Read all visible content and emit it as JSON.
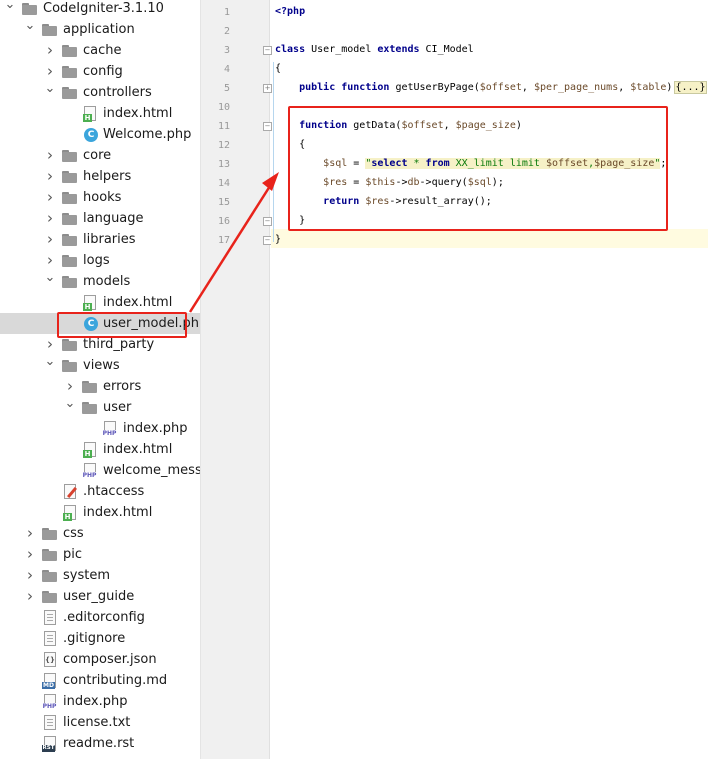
{
  "tree": {
    "items": [
      {
        "label": "CodeIgniter-3.1.10",
        "kind": "folder",
        "depth": 0,
        "open": true
      },
      {
        "label": "application",
        "kind": "folder",
        "depth": 1,
        "open": true
      },
      {
        "label": "cache",
        "kind": "folder",
        "depth": 2,
        "open": false
      },
      {
        "label": "config",
        "kind": "folder",
        "depth": 2,
        "open": false
      },
      {
        "label": "controllers",
        "kind": "folder",
        "depth": 2,
        "open": true
      },
      {
        "label": "index.html",
        "kind": "html",
        "depth": 3
      },
      {
        "label": "Welcome.php",
        "kind": "class",
        "depth": 3
      },
      {
        "label": "core",
        "kind": "folder",
        "depth": 2,
        "open": false
      },
      {
        "label": "helpers",
        "kind": "folder",
        "depth": 2,
        "open": false
      },
      {
        "label": "hooks",
        "kind": "folder",
        "depth": 2,
        "open": false
      },
      {
        "label": "language",
        "kind": "folder",
        "depth": 2,
        "open": false
      },
      {
        "label": "libraries",
        "kind": "folder",
        "depth": 2,
        "open": false
      },
      {
        "label": "logs",
        "kind": "folder",
        "depth": 2,
        "open": false
      },
      {
        "label": "models",
        "kind": "folder",
        "depth": 2,
        "open": true
      },
      {
        "label": "index.html",
        "kind": "html",
        "depth": 3
      },
      {
        "label": "user_model.php",
        "kind": "class",
        "depth": 3,
        "selected": true
      },
      {
        "label": "third_party",
        "kind": "folder",
        "depth": 2,
        "open": false
      },
      {
        "label": "views",
        "kind": "folder",
        "depth": 2,
        "open": true
      },
      {
        "label": "errors",
        "kind": "folder",
        "depth": 3,
        "open": false
      },
      {
        "label": "user",
        "kind": "folder",
        "depth": 3,
        "open": true
      },
      {
        "label": "index.php",
        "kind": "php",
        "depth": 4
      },
      {
        "label": "index.html",
        "kind": "html",
        "depth": 3
      },
      {
        "label": "welcome_message.php",
        "kind": "php",
        "depth": 3
      },
      {
        "label": ".htaccess",
        "kind": "htaccess",
        "depth": 2
      },
      {
        "label": "index.html",
        "kind": "html",
        "depth": 2
      },
      {
        "label": "css",
        "kind": "folder",
        "depth": 1,
        "open": false
      },
      {
        "label": "pic",
        "kind": "folder",
        "depth": 1,
        "open": false
      },
      {
        "label": "system",
        "kind": "folder",
        "depth": 1,
        "open": false
      },
      {
        "label": "user_guide",
        "kind": "folder",
        "depth": 1,
        "open": false
      },
      {
        "label": ".editorconfig",
        "kind": "text",
        "depth": 1
      },
      {
        "label": ".gitignore",
        "kind": "text",
        "depth": 1
      },
      {
        "label": "composer.json",
        "kind": "json",
        "depth": 1
      },
      {
        "label": "contributing.md",
        "kind": "md",
        "depth": 1
      },
      {
        "label": "index.php",
        "kind": "php",
        "depth": 1
      },
      {
        "label": "license.txt",
        "kind": "text",
        "depth": 1
      },
      {
        "label": "readme.rst",
        "kind": "rst",
        "depth": 1
      }
    ]
  },
  "icons": {
    "folder": "folder-icon",
    "html": "html-file-icon",
    "class": "php-class-icon",
    "php": "php-file-icon",
    "htaccess": "htaccess-file-icon",
    "text": "text-file-icon",
    "json": "json-file-icon",
    "md": "markdown-file-icon",
    "rst": "rst-file-icon",
    "badges": {
      "html": "H",
      "class": "C",
      "php": "PHP",
      "md": "MD",
      "rst": "RST",
      "json": "{}"
    }
  },
  "editor": {
    "line_numbers": [
      "1",
      "2",
      "3",
      "4",
      "5",
      "10",
      "11",
      "12",
      "13",
      "14",
      "15",
      "16",
      "17"
    ],
    "folded_placeholder": "{...}",
    "lines": [
      {
        "n": "1",
        "tokens": [
          [
            "tag",
            "<?php"
          ]
        ]
      },
      {
        "n": "2",
        "tokens": []
      },
      {
        "n": "3",
        "tokens": [
          [
            "kw",
            "class"
          ],
          [
            "plain",
            " User_model "
          ],
          [
            "kw",
            "extends"
          ],
          [
            "plain",
            " CI_Model"
          ]
        ]
      },
      {
        "n": "4",
        "tokens": [
          [
            "plain",
            "{"
          ]
        ]
      },
      {
        "n": "5",
        "tokens": [
          [
            "plain",
            "    "
          ],
          [
            "kw",
            "public"
          ],
          [
            "plain",
            " "
          ],
          [
            "kw",
            "function"
          ],
          [
            "plain",
            " getUserByPage("
          ],
          [
            "var",
            "$offset"
          ],
          [
            "plain",
            ", "
          ],
          [
            "var",
            "$per_page_nums"
          ],
          [
            "plain",
            ", "
          ],
          [
            "var",
            "$table"
          ],
          [
            "plain",
            ")"
          ]
        ]
      },
      {
        "n": "10",
        "tokens": []
      },
      {
        "n": "11",
        "tokens": [
          [
            "plain",
            "    "
          ],
          [
            "kw",
            "function"
          ],
          [
            "plain",
            " getData("
          ],
          [
            "var",
            "$offset"
          ],
          [
            "plain",
            ", "
          ],
          [
            "var",
            "$page_size"
          ],
          [
            "plain",
            ")"
          ]
        ]
      },
      {
        "n": "12",
        "tokens": [
          [
            "plain",
            "    {"
          ]
        ]
      },
      {
        "n": "13",
        "tokens": [
          [
            "plain",
            "        "
          ],
          [
            "var",
            "$sql"
          ],
          [
            "plain",
            " = "
          ],
          [
            "str",
            "\""
          ],
          [
            "strkw",
            "select"
          ],
          [
            "str",
            " * "
          ],
          [
            "strkw",
            "from"
          ],
          [
            "str",
            " XX_limit limit "
          ],
          [
            "strvar",
            "$offset"
          ],
          [
            "str",
            ","
          ],
          [
            "strvar",
            "$page_size"
          ],
          [
            "str",
            "\""
          ],
          [
            "plain",
            ";"
          ]
        ]
      },
      {
        "n": "14",
        "tokens": [
          [
            "plain",
            "        "
          ],
          [
            "var",
            "$res"
          ],
          [
            "plain",
            " = "
          ],
          [
            "var",
            "$this"
          ],
          [
            "plain",
            "->"
          ],
          [
            "var",
            "db"
          ],
          [
            "plain",
            "->query("
          ],
          [
            "var",
            "$sql"
          ],
          [
            "plain",
            ");"
          ]
        ]
      },
      {
        "n": "15",
        "tokens": [
          [
            "plain",
            "        "
          ],
          [
            "kw",
            "return"
          ],
          [
            "plain",
            " "
          ],
          [
            "var",
            "$res"
          ],
          [
            "plain",
            "->result_array();"
          ]
        ]
      },
      {
        "n": "16",
        "tokens": [
          [
            "plain",
            "    }"
          ]
        ]
      },
      {
        "n": "17",
        "tokens": [
          [
            "plain",
            "}"
          ]
        ]
      }
    ]
  },
  "colors": {
    "annotation": "#e8231b",
    "selection": "#d9d9d9",
    "keyword": "#00008b",
    "string": "#0a7a0a",
    "current_line": "#fffbe0"
  }
}
